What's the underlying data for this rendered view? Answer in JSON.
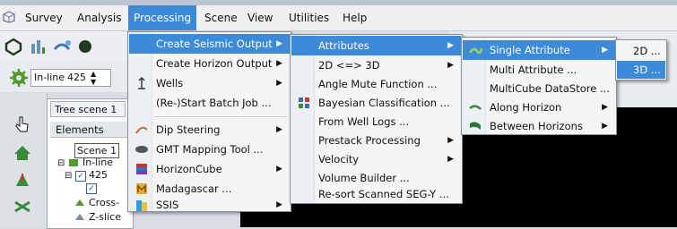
{
  "menubar": {
    "items": [
      "Survey",
      "Analysis",
      "Processing",
      "Scene",
      "View",
      "Utilities",
      "Help"
    ]
  },
  "toolbar": {
    "inline_label": "In-line",
    "inline_value": "425"
  },
  "tree": {
    "tab": "Tree scene 1",
    "elements_header": "Elements",
    "items": [
      "Scene 1",
      "In-line",
      "425",
      "Cross-",
      "Z-slice"
    ]
  },
  "processing_menu": {
    "items": [
      {
        "label": "Create Seismic Output",
        "submenu": true,
        "icon": ""
      },
      {
        "label": "Create Horizon Output",
        "submenu": true,
        "icon": ""
      },
      {
        "label": "Wells",
        "submenu": true,
        "icon": "well-icon"
      },
      {
        "label": "(Re-)Start Batch Job ...",
        "submenu": false,
        "icon": ""
      },
      {
        "label": "Dip Steering",
        "submenu": true,
        "icon": "dip-steering-icon"
      },
      {
        "label": "GMT Mapping Tool ...",
        "submenu": false,
        "icon": "gmt-icon"
      },
      {
        "label": "HorizonCube",
        "submenu": true,
        "icon": "horizoncube-icon"
      },
      {
        "label": "Madagascar ...",
        "submenu": false,
        "icon": "madagascar-icon"
      },
      {
        "label": "SSIS",
        "submenu": true,
        "icon": "ssis-icon"
      }
    ]
  },
  "seismic_output_menu": {
    "items": [
      {
        "label": "Attributes",
        "submenu": true
      },
      {
        "label": "2D <=> 3D",
        "submenu": true
      },
      {
        "label": "Angle Mute Function ...",
        "submenu": false
      },
      {
        "label": "Bayesian Classification ...",
        "submenu": false,
        "icon": "bayesian-icon"
      },
      {
        "label": "From Well Logs ...",
        "submenu": false
      },
      {
        "label": "Prestack Processing",
        "submenu": true
      },
      {
        "label": "Velocity",
        "submenu": true
      },
      {
        "label": "Volume Builder ...",
        "submenu": false
      },
      {
        "label": "Re-sort Scanned SEG-Y ...",
        "submenu": false
      }
    ]
  },
  "attributes_menu": {
    "items": [
      {
        "label": "Single Attribute",
        "submenu": true,
        "icon": "single-attribute-icon"
      },
      {
        "label": "Multi Attribute ...",
        "submenu": false
      },
      {
        "label": "MultiCube DataStore ...",
        "submenu": false
      },
      {
        "label": "Along Horizon",
        "submenu": true,
        "icon": "along-horizon-icon"
      },
      {
        "label": "Between Horizons",
        "submenu": true,
        "icon": "between-horizons-icon"
      }
    ]
  },
  "single_attribute_menu": {
    "items": [
      "2D ...",
      "3D ..."
    ]
  },
  "colors": {
    "highlight": "#3c8ad8",
    "menu_bg": "#f5f5f5",
    "scene_bg": "#000000"
  }
}
